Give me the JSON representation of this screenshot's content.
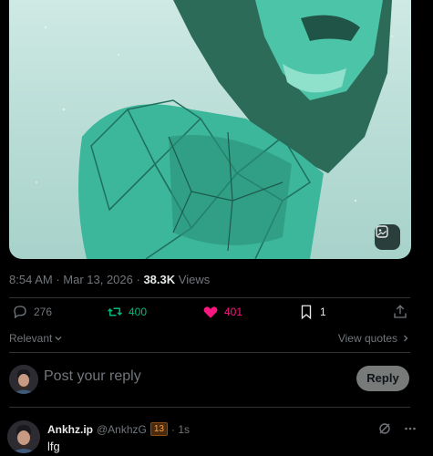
{
  "tweet": {
    "time": "8:54 AM",
    "separator": " · ",
    "date": "Mar 13, 2026",
    "views_count": "38.3K",
    "views_label": "Views"
  },
  "actions": {
    "replies": "276",
    "retweets": "400",
    "likes": "401",
    "bookmarks": "1"
  },
  "sort": {
    "label": "Relevant",
    "view_quotes": "View quotes"
  },
  "composer": {
    "placeholder": "Post your reply",
    "reply_button": "Reply"
  },
  "reply": {
    "name": "Ankhz.ip",
    "handle": "@AnkhzG",
    "badge": "13",
    "time": "· 1s",
    "text": "lfg"
  },
  "colors": {
    "retweet": "#00ba7c",
    "like": "#f91880",
    "muted": "#71767b"
  },
  "icons": [
    "reply-icon",
    "retweet-icon",
    "heart-icon",
    "bookmark-icon",
    "share-icon",
    "grok-image-icon",
    "chevron-down-icon",
    "chevron-right-icon",
    "grok-icon",
    "more-icon"
  ]
}
